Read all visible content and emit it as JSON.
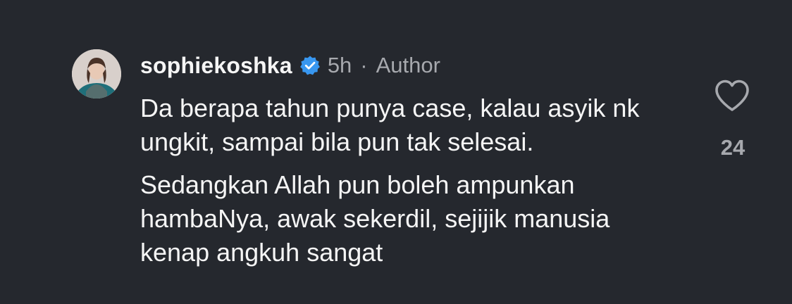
{
  "comment": {
    "username": "sophiekoshka",
    "time": "5h",
    "separator": "·",
    "role": "Author",
    "paragraphs": [
      "Da berapa tahun punya case, kalau asyik nk ungkit, sampai bila pun tak selesai.",
      "Sedangkan Allah pun boleh ampunkan hambaNya, awak sekerdil, sejijik manusia kenap angkuh sangat"
    ],
    "like_count": "24"
  },
  "icons": {
    "avatar": "user-avatar",
    "verified": "verified-badge-icon",
    "like": "heart-outline-icon"
  },
  "colors": {
    "background": "#25282e",
    "text": "#f5f5f5",
    "secondary_text": "#a7a9ae",
    "verified_badge": "#3897f0"
  }
}
